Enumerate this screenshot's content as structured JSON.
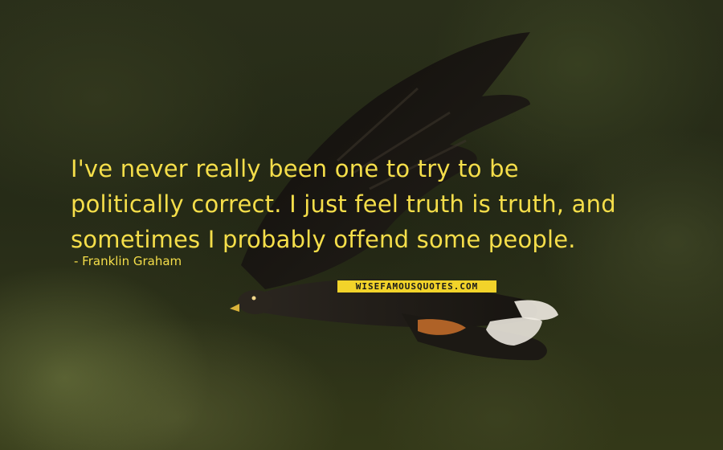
{
  "quote": {
    "lines": [
      "I've never really been one to try to be",
      "politically correct. I just feel truth is truth, and",
      "sometimes I probably offend some people."
    ],
    "text_color": "#f5de4a"
  },
  "author": {
    "text": "- Franklin Graham"
  },
  "watermark": {
    "text": "WISEFAMOUSQUOTES.COM",
    "background": "#f2d32a"
  },
  "background": {
    "subject": "bird-in-flight"
  }
}
